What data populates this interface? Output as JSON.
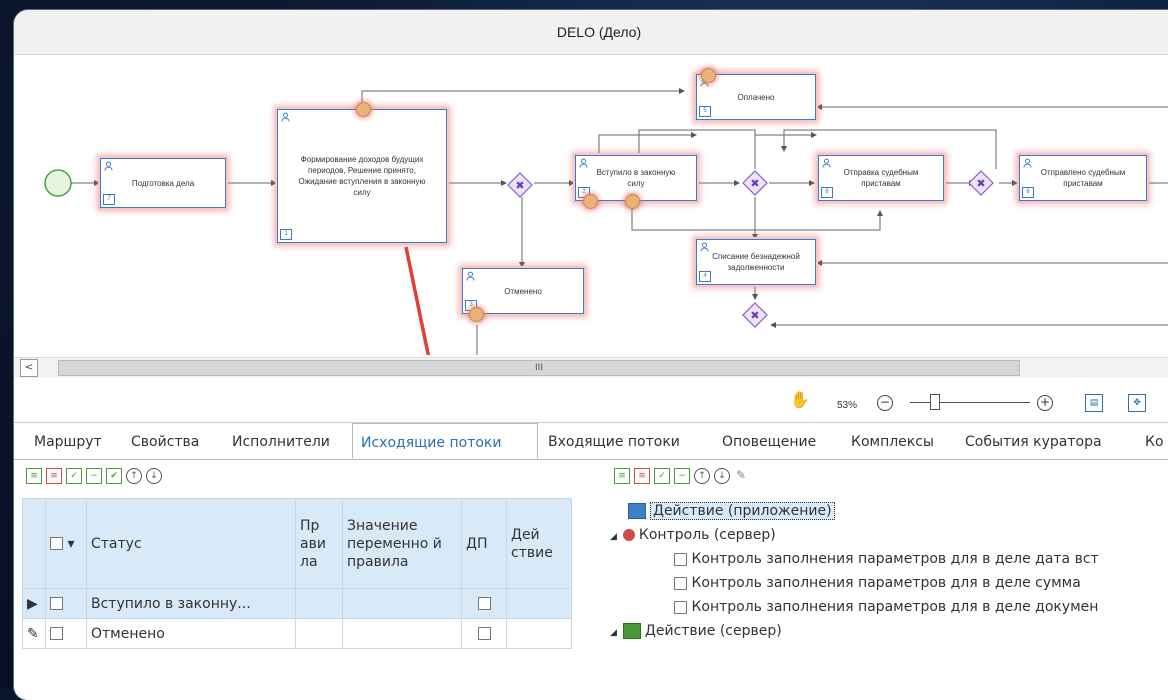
{
  "window": {
    "title": "DELO (Дело)"
  },
  "diagram": {
    "nodes": {
      "prep": {
        "label": "Подготовка дела",
        "num": "7"
      },
      "forming": {
        "label": "Формирование доходов будущих периодов, Решение принято, Ожидание вступления в законную силу",
        "num": "1"
      },
      "paid": {
        "label": "Оплачено",
        "num": "5"
      },
      "entered": {
        "label": "Вступило в законную силу",
        "num": "2"
      },
      "bailiffs": {
        "label": "Отправка судебным приставам",
        "num": "6"
      },
      "sent": {
        "label": "Отправлено судебным приставам",
        "num": "6"
      },
      "writeoff": {
        "label": "Списание безнадежной задолженности",
        "num": "4"
      },
      "cancelled": {
        "label": "Отменено",
        "num": "3"
      }
    }
  },
  "scrollbar": {
    "thumb_label": "III"
  },
  "zoom": {
    "level": "53%",
    "minus": "−",
    "plus": "+"
  },
  "tabs": [
    {
      "label": "Маршрут"
    },
    {
      "label": "Свойства"
    },
    {
      "label": "Исполнители"
    },
    {
      "label": "Исходящие потоки",
      "active": true
    },
    {
      "label": "Входящие потоки"
    },
    {
      "label": "Оповещение"
    },
    {
      "label": "Комплексы"
    },
    {
      "label": "События куратора"
    },
    {
      "label": "Ко"
    }
  ],
  "outgoing": {
    "columns": {
      "status": "Статус",
      "rules": "Пр ави ла",
      "value": "Значение переменно й правила",
      "dp": "ДП",
      "action": "Дей ствие"
    },
    "rows": [
      {
        "marker": "▶",
        "status": "Вступило в законну..."
      },
      {
        "marker": "✎",
        "status": "Отменено"
      }
    ]
  },
  "actions_tree": {
    "items": [
      {
        "label": "Действие (приложение)"
      },
      {
        "label": "Контроль (сервер)"
      },
      {
        "label": "Контроль заполнения параметров для  в деле дата вст"
      },
      {
        "label": "Контроль заполнения параметров для в деле сумма"
      },
      {
        "label": "Контроль заполнения параметров для в деле докумен"
      },
      {
        "label": "Действие (сервер)"
      }
    ]
  }
}
